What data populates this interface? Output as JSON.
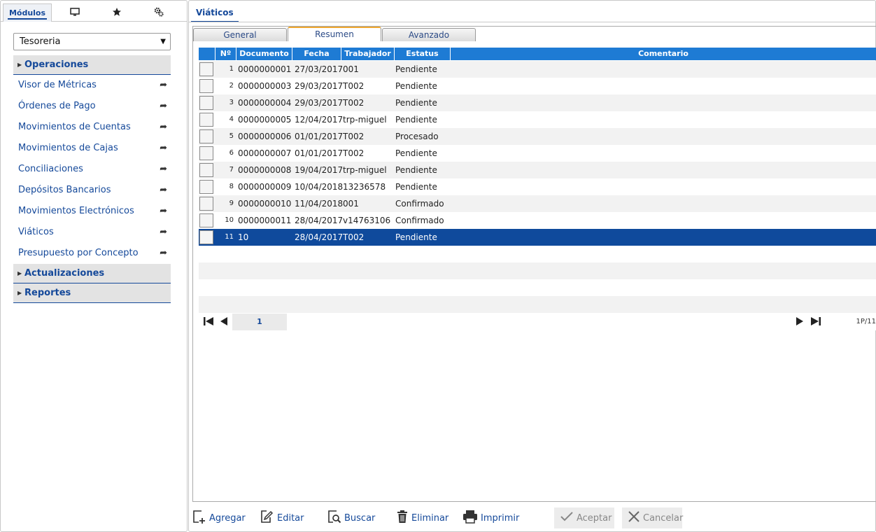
{
  "left_panel": {
    "tabs": [
      {
        "label": "Módulos",
        "icon": "modules-tab"
      },
      {
        "label": "",
        "icon": "monitor-icon"
      },
      {
        "label": "",
        "icon": "star-icon"
      },
      {
        "label": "",
        "icon": "gears-icon"
      }
    ],
    "module_select": {
      "value": "Tesoreria"
    },
    "sections": {
      "operaciones": "Operaciones",
      "actualizaciones": "Actualizaciones",
      "reportes": "Reportes"
    },
    "items": [
      {
        "label": "Visor de Métricas"
      },
      {
        "label": "Órdenes de Pago"
      },
      {
        "label": "Movimientos de Cuentas"
      },
      {
        "label": "Movimientos de Cajas"
      },
      {
        "label": "Conciliaciones"
      },
      {
        "label": "Depósitos Bancarios"
      },
      {
        "label": "Movimientos Electrónicos"
      },
      {
        "label": "Viáticos"
      },
      {
        "label": "Presupuesto por Concepto"
      }
    ]
  },
  "main": {
    "tab_title": "Viáticos",
    "subtabs": [
      "General",
      "Resumen",
      "Avanzado"
    ],
    "active_subtab": "Resumen",
    "columns": [
      "Nº",
      "Documento",
      "Fecha",
      "Trabajador",
      "Estatus",
      "Comentario"
    ],
    "rows": [
      {
        "n": "1",
        "doc": "0000000001",
        "fecha": "27/03/2017",
        "trab": "001",
        "estatus": "Pendiente",
        "coment": ""
      },
      {
        "n": "2",
        "doc": "0000000003",
        "fecha": "29/03/2017",
        "trab": "T002",
        "estatus": "Pendiente",
        "coment": ""
      },
      {
        "n": "3",
        "doc": "0000000004",
        "fecha": "29/03/2017",
        "trab": "T002",
        "estatus": "Pendiente",
        "coment": ""
      },
      {
        "n": "4",
        "doc": "0000000005",
        "fecha": "12/04/2017",
        "trab": "trp-miguel",
        "estatus": "Pendiente",
        "coment": ""
      },
      {
        "n": "5",
        "doc": "0000000006",
        "fecha": "01/01/2017",
        "trab": "T002",
        "estatus": "Procesado",
        "coment": ""
      },
      {
        "n": "6",
        "doc": "0000000007",
        "fecha": "01/01/2017",
        "trab": "T002",
        "estatus": "Pendiente",
        "coment": ""
      },
      {
        "n": "7",
        "doc": "0000000008",
        "fecha": "19/04/2017",
        "trab": "trp-miguel",
        "estatus": "Pendiente",
        "coment": ""
      },
      {
        "n": "8",
        "doc": "0000000009",
        "fecha": "10/04/2018",
        "trab": "13236578",
        "estatus": "Pendiente",
        "coment": ""
      },
      {
        "n": "9",
        "doc": "0000000010",
        "fecha": "11/04/2018",
        "trab": "001",
        "estatus": "Confirmado",
        "coment": ""
      },
      {
        "n": "10",
        "doc": "0000000011",
        "fecha": "28/04/2017",
        "trab": "v14763106",
        "estatus": "Confirmado",
        "coment": ""
      },
      {
        "n": "11",
        "doc": "10",
        "fecha": "28/04/2017",
        "trab": "T002",
        "estatus": "Pendiente",
        "coment": ""
      }
    ],
    "selected_row": 11,
    "pager": {
      "page": "1",
      "info": "1P/11"
    }
  },
  "toolbar": {
    "agregar": "Agregar",
    "editar": "Editar",
    "buscar": "Buscar",
    "eliminar": "Eliminar",
    "imprimir": "Imprimir",
    "aceptar": "Aceptar",
    "cancelar": "Cancelar"
  },
  "colors": {
    "brand": "#15499a",
    "header_blue": "#1e7bd4",
    "selected_row": "#0f4a9c",
    "active_tab_accent": "#f0a830"
  }
}
